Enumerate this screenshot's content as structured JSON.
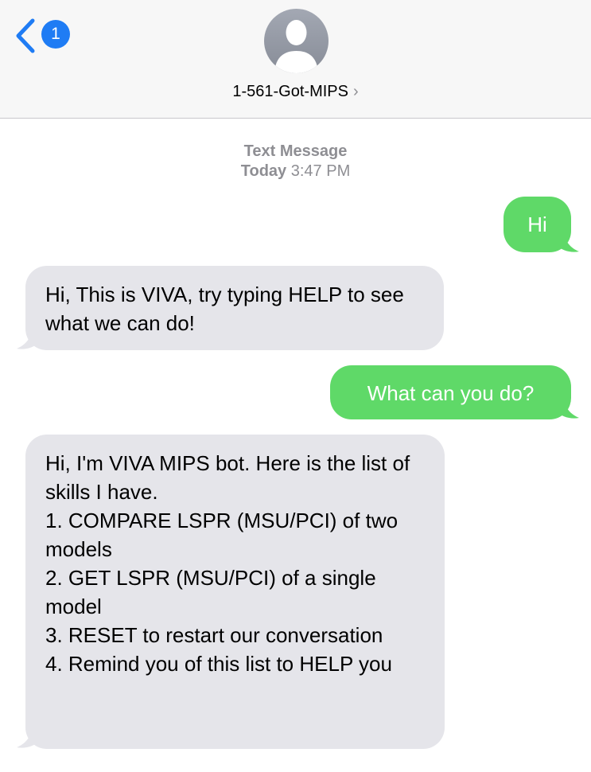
{
  "header": {
    "back_badge": "1",
    "contact_name": "1-561-Got-MIPS",
    "contact_chevron": "›"
  },
  "meta": {
    "service": "Text Message",
    "day": "Today",
    "time": "3:47 PM"
  },
  "messages": [
    {
      "direction": "sent",
      "text": "Hi"
    },
    {
      "direction": "received",
      "text": "Hi, This is VIVA, try typing HELP to see what we can do!"
    },
    {
      "direction": "sent",
      "text": "What can you do?"
    },
    {
      "direction": "received",
      "lines": [
        "Hi, I'm VIVA MIPS bot. Here is the list of skills I have.",
        "1. COMPARE LSPR (MSU/PCI) of two models",
        "2. GET LSPR (MSU/PCI) of a single model",
        "3. RESET to restart our conversation",
        "4. Remind you of this list to HELP you"
      ]
    }
  ],
  "colors": {
    "sent_bubble": "#5fd968",
    "received_bubble": "#e5e5ea",
    "accent_blue": "#1f7cf4",
    "meta_gray": "#8e8e93"
  },
  "icons": {
    "back": "chevron-left-icon",
    "avatar": "person-silhouette-icon",
    "contact_chevron": "chevron-right-icon"
  }
}
